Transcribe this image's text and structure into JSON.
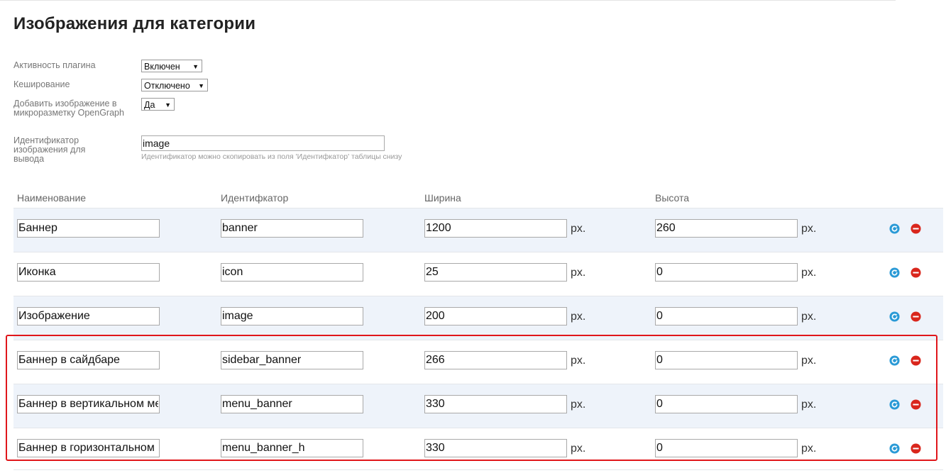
{
  "page": {
    "title": "Изображения для категории"
  },
  "settings": {
    "plugin_active": {
      "label": "Активность плагина",
      "value": "Включен"
    },
    "caching": {
      "label": "Кеширование",
      "value": "Отключено"
    },
    "opengraph": {
      "label": "Добавить изображение в микроразметку OpenGraph",
      "value": "Да"
    },
    "output_id": {
      "label": "Идентификатор изображения для вывода",
      "value": "image",
      "hint": "Идентификатор можно скопировать из поля 'Идентифкатор' таблицы снизу"
    }
  },
  "table": {
    "headers": {
      "name": "Наименование",
      "identifier": "Идентифкатор",
      "width": "Ширина",
      "height": "Высота"
    },
    "unit": "px.",
    "rows": [
      {
        "name": "Баннер",
        "identifier": "banner",
        "width": "1200",
        "height": "260"
      },
      {
        "name": "Иконка",
        "identifier": "icon",
        "width": "25",
        "height": "0"
      },
      {
        "name": "Изображение",
        "identifier": "image",
        "width": "200",
        "height": "0"
      },
      {
        "name": "Баннер в сайдбаре",
        "identifier": "sidebar_banner",
        "width": "266",
        "height": "0"
      },
      {
        "name": "Баннер в вертикальном меню",
        "identifier": "menu_banner",
        "width": "330",
        "height": "0"
      },
      {
        "name": "Баннер в горизонтальном меню",
        "identifier": "menu_banner_h",
        "width": "330",
        "height": "0"
      }
    ],
    "row_icons": [
      "refresh-icon",
      "remove-icon"
    ]
  },
  "colors": {
    "row_odd": "#eef3fa",
    "highlight": "#e0161b",
    "refresh_icon": "#2a9ad6",
    "remove_icon": "#d9261c"
  }
}
